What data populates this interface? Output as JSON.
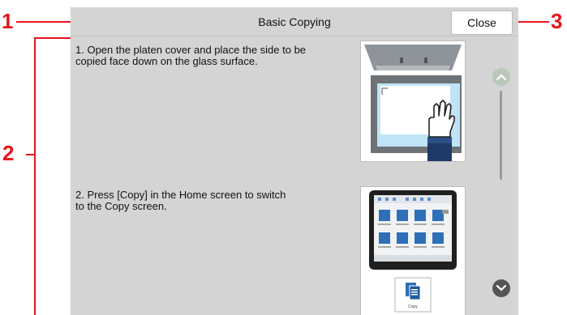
{
  "callouts": {
    "one": "1",
    "two": "2",
    "three": "3"
  },
  "header": {
    "title": "Basic Copying",
    "close_label": "Close"
  },
  "steps": [
    {
      "text": "1. Open the platen cover and place the side to be copied face down on the glass surface."
    },
    {
      "text": "2. Press [Copy] in the Home screen to switch to the Copy screen."
    }
  ],
  "illustration": {
    "copy_label": "Copy"
  },
  "colors": {
    "callout": "#e8141b",
    "screen_bg": "#d4d4d4",
    "hand_glove": "#ffffff",
    "sleeve": "#1e3a66",
    "glass": "#bfe3f7"
  }
}
